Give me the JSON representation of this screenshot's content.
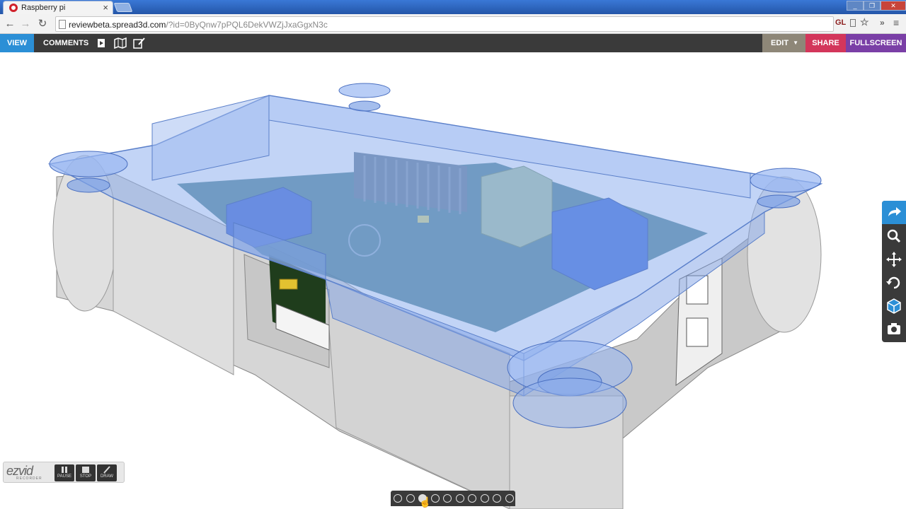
{
  "browser": {
    "tab_title": "Raspberry pi",
    "tab_close": "×",
    "url_host": "reviewbeta.spread3d.com",
    "url_path": "/?id=0ByQnw7pPQL6DekVWZjJxaGgxN3c",
    "back_icon": "←",
    "forward_icon": "→",
    "reload_icon": "↻",
    "ext_gl": "GL",
    "star_icon": "☆",
    "arrows": "»",
    "menu_icon": "≡"
  },
  "appbar": {
    "view_label": "VIEW",
    "comments_label": "COMMENTS",
    "edit_label": "EDIT",
    "edit_caret": "▼",
    "share_label": "SHARE",
    "fullscreen_label": "FULLSCREEN",
    "colors": {
      "view": "#2b8fd6",
      "edit": "#8e8778",
      "share": "#d3365b",
      "fullscreen": "#7a3fa6"
    }
  },
  "side_tools": [
    "share-arrow-icon",
    "zoom-icon",
    "pan-icon",
    "rotate-icon",
    "cube-icon",
    "camera-icon"
  ],
  "pagination": {
    "count": 10,
    "active_index": 2
  },
  "recorder": {
    "logo": "ezvid",
    "sub": "RECORDER",
    "buttons": [
      "PAUSE",
      "STOP",
      "DRAW"
    ]
  }
}
